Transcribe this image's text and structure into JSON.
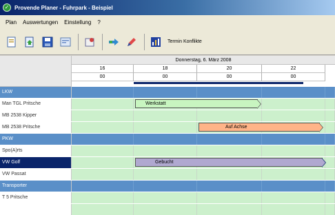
{
  "window": {
    "title": "Provende Planer - Fuhrpark - Beispiel",
    "colors": {
      "titlebar": "#0a246a",
      "group": "#5a8fc8",
      "free": "#ccf0cc",
      "bar_green": "#c8f5c0",
      "bar_orange": "#ffb488",
      "bar_purple": "#b0a8d0"
    }
  },
  "menu": {
    "items": [
      "Plan",
      "Auswertungen",
      "Einstellung",
      "?"
    ]
  },
  "toolbar": {
    "buttons": [
      "new-icon",
      "open-icon",
      "save-icon",
      "view-icon",
      "tool-icon",
      "transfer-icon",
      "pen-icon",
      "chart-icon"
    ],
    "conflicts_label": "Termin Konflikte"
  },
  "gantt": {
    "date": "Donnerstag, 6. März 2008",
    "hours": [
      "16",
      "18",
      "20",
      "22"
    ],
    "minutes": [
      "00",
      "00",
      "00",
      "00"
    ],
    "rows": [
      {
        "type": "group",
        "label": "LKW"
      },
      {
        "type": "resource",
        "label": "Man TGL Pritsche",
        "bar": {
          "text": "Werkstatt",
          "color": "green"
        }
      },
      {
        "type": "resource",
        "label": "MB 2538 Kipper"
      },
      {
        "type": "resource",
        "label": "MB 2538 Pritsche",
        "bar": {
          "text": "Auf Achse",
          "color": "orange"
        }
      },
      {
        "type": "group",
        "label": "PKW"
      },
      {
        "type": "resource",
        "label": "Spo(A)rts"
      },
      {
        "type": "resource",
        "label": "VW Golf",
        "selected": true,
        "bar": {
          "text": "Gebucht",
          "color": "purple"
        }
      },
      {
        "type": "resource",
        "label": "VW Passat"
      },
      {
        "type": "group",
        "label": "Transporter"
      },
      {
        "type": "resource",
        "label": "T 5 Pritsche"
      }
    ]
  }
}
